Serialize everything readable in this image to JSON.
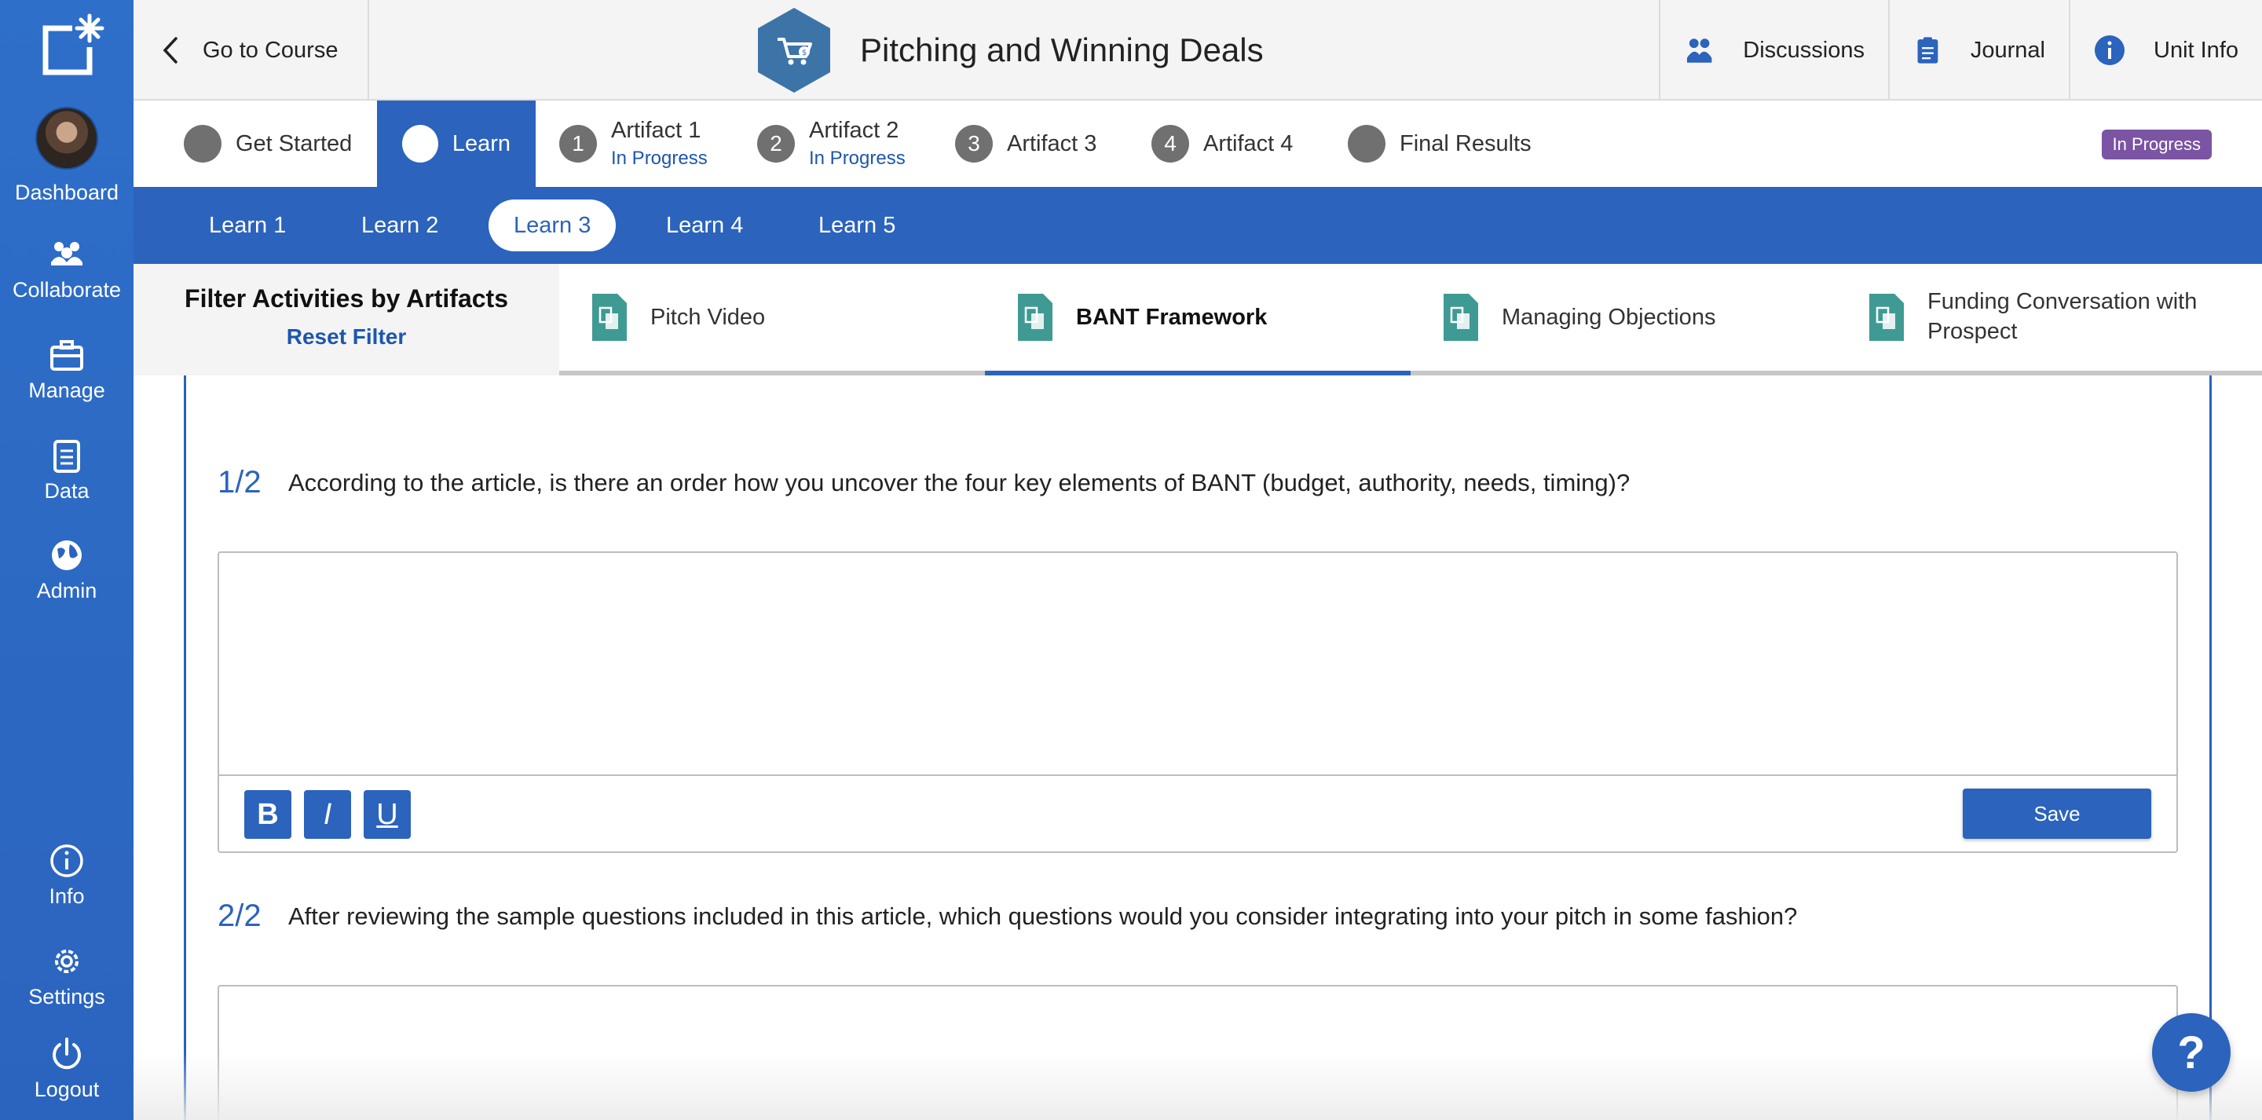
{
  "sidebar": {
    "logo_icon": "sparkle-square-icon",
    "items": [
      {
        "label": "Dashboard",
        "icon": "avatar"
      },
      {
        "label": "Collaborate",
        "icon": "people-icon"
      },
      {
        "label": "Manage",
        "icon": "briefcase-icon"
      },
      {
        "label": "Data",
        "icon": "clipboard-icon"
      },
      {
        "label": "Admin",
        "icon": "globe-icon"
      },
      {
        "label": "Info",
        "icon": "info-icon"
      },
      {
        "label": "Settings",
        "icon": "gear-icon"
      },
      {
        "label": "Logout",
        "icon": "power-icon"
      }
    ]
  },
  "header": {
    "back_label": "Go to Course",
    "course_title": "Pitching and Winning Deals",
    "course_icon": "cart-hexagon-icon",
    "links": [
      {
        "label": "Discussions",
        "icon": "people-icon"
      },
      {
        "label": "Journal",
        "icon": "journal-icon"
      },
      {
        "label": "Unit Info",
        "icon": "info-icon"
      }
    ]
  },
  "steps": {
    "items": [
      {
        "label": "Get Started",
        "num": "",
        "sub": ""
      },
      {
        "label": "Learn",
        "num": "",
        "sub": ""
      },
      {
        "label": "Artifact 1",
        "num": "1",
        "sub": "In Progress"
      },
      {
        "label": "Artifact 2",
        "num": "2",
        "sub": "In Progress"
      },
      {
        "label": "Artifact 3",
        "num": "3",
        "sub": ""
      },
      {
        "label": "Artifact 4",
        "num": "4",
        "sub": ""
      },
      {
        "label": "Final Results",
        "num": "",
        "sub": ""
      }
    ],
    "status_badge": "In Progress"
  },
  "learn_tabs": [
    "Learn 1",
    "Learn 2",
    "Learn 3",
    "Learn 4",
    "Learn 5"
  ],
  "filter": {
    "title": "Filter Activities by Artifacts",
    "reset": "Reset Filter",
    "tabs": [
      "Pitch Video",
      "BANT Framework",
      "Managing Objections",
      "Funding Conversation with Prospect"
    ]
  },
  "questions": [
    {
      "num": "1/2",
      "text": "According to the article, is there an order how you uncover the four key elements of BANT (budget, authority, needs, timing)?"
    },
    {
      "num": "2/2",
      "text": "After reviewing the sample questions included in this article, which questions would you consider integrating into your pitch in some fashion?"
    }
  ],
  "editor": {
    "bold": "B",
    "italic": "I",
    "underline": "U",
    "save": "Save"
  },
  "help_label": "?",
  "colors": {
    "primary": "#2b63bd",
    "badge": "#7b54a3",
    "teal": "#3f9a93"
  }
}
